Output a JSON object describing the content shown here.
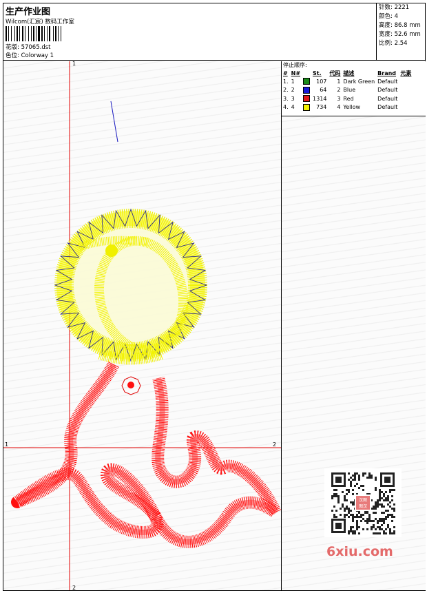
{
  "header": {
    "title": "生产作业图",
    "company": "Wilcom(汇宸) 数码工作室",
    "design_label": "花版:",
    "design_value": "57065.dst",
    "colorway_label": "色位:",
    "colorway_value": "Colorway 1"
  },
  "stats": [
    {
      "label": "针数:",
      "value": "2221"
    },
    {
      "label": "颜色:",
      "value": "4"
    },
    {
      "label": "高度:",
      "value": "86.8 mm"
    },
    {
      "label": "宽度:",
      "value": "52.6 mm"
    },
    {
      "label": "比例:",
      "value": "2.54"
    }
  ],
  "stops": {
    "label": "停止顺序:",
    "columns": [
      "#",
      "N#",
      "St.",
      "代码",
      "描述",
      "Brand",
      "元素"
    ],
    "rows": [
      {
        "idx": "1.",
        "n": "1",
        "color": "#1a8a1a",
        "st": "107",
        "code": "1",
        "desc": "Dark Green",
        "brand": "Default"
      },
      {
        "idx": "2.",
        "n": "2",
        "color": "#1818d8",
        "st": "64",
        "code": "2",
        "desc": "Blue",
        "brand": "Default"
      },
      {
        "idx": "3.",
        "n": "3",
        "color": "#e01818",
        "st": "1314",
        "code": "3",
        "desc": "Red",
        "brand": "Default"
      },
      {
        "idx": "4.",
        "n": "4",
        "color": "#f2f200",
        "st": "734",
        "code": "4",
        "desc": "Yellow",
        "brand": "Default"
      }
    ]
  },
  "axes": {
    "v_top": "1",
    "v_bottom": "2",
    "h_left": "1",
    "h_right": "2"
  },
  "watermark": {
    "text": "6xiu.com",
    "seal_text": "汉图图汉"
  },
  "colors": {
    "guide_line": "#e00000",
    "red": "#ff1010",
    "yellow": "#f0f000",
    "blue": "#1818c0"
  }
}
